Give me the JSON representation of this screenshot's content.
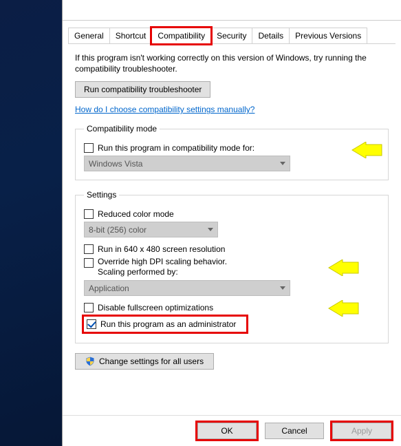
{
  "tabs": {
    "general": "General",
    "shortcut": "Shortcut",
    "compatibility": "Compatibility",
    "security": "Security",
    "details": "Details",
    "previous": "Previous Versions"
  },
  "intro": "If this program isn't working correctly on this version of Windows, try running the compatibility troubleshooter.",
  "troubleshoot_btn": "Run compatibility troubleshooter",
  "manual_link": "How do I choose compatibility settings manually?",
  "compat_mode": {
    "legend": "Compatibility mode",
    "run_for": "Run this program in compatibility mode for:",
    "combo": "Windows Vista"
  },
  "settings": {
    "legend": "Settings",
    "reduced_color": "Reduced color mode",
    "color_combo": "8-bit (256) color",
    "run_640": "Run in 640 x 480 screen resolution",
    "dpi_override": "Override high DPI scaling behavior.\nScaling performed by:",
    "dpi_combo": "Application",
    "disable_fs": "Disable fullscreen optimizations",
    "run_admin": "Run this program as an administrator"
  },
  "all_users_btn": "Change settings for all users",
  "buttons": {
    "ok": "OK",
    "cancel": "Cancel",
    "apply": "Apply"
  }
}
